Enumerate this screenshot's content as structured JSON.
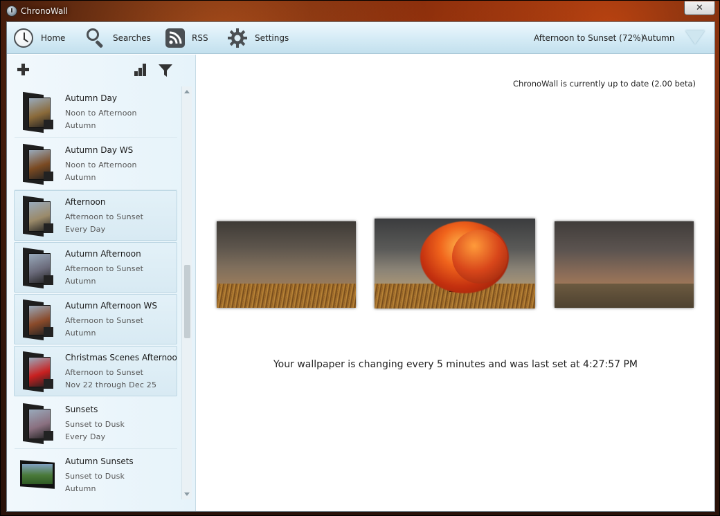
{
  "window": {
    "title": "ChronoWall",
    "close_label": "✕"
  },
  "toolbar": {
    "home_label": "Home",
    "searches_label": "Searches",
    "rss_label": "RSS",
    "settings_label": "Settings",
    "current_period": "Afternoon to Sunset (72%)",
    "current_theme": "Autumn"
  },
  "main": {
    "update_status": "ChronoWall is currently up to date (2.00 beta)",
    "caption": "Your wallpaper is changing every 5 minutes and was last set at 4:27:57 PM"
  },
  "sidebar": {
    "items": [
      {
        "name": "Autumn Day",
        "period": "Noon to Afternoon",
        "schedule": "Autumn",
        "highlighted": false,
        "pic": "#8a6a3a"
      },
      {
        "name": "Autumn Day WS",
        "period": "Noon to Afternoon",
        "schedule": "Autumn",
        "highlighted": false,
        "pic": "#7a4a22"
      },
      {
        "name": "Afternoon",
        "period": "Afternoon to Sunset",
        "schedule": "Every Day",
        "highlighted": true,
        "pic": "#9a8a6a"
      },
      {
        "name": "Autumn Afternoon",
        "period": "Afternoon to Sunset",
        "schedule": "Autumn",
        "highlighted": true,
        "pic": "#6a6a7a"
      },
      {
        "name": "Autumn Afternoon WS",
        "period": "Afternoon to Sunset",
        "schedule": "Autumn",
        "highlighted": true,
        "pic": "#8a4a2a"
      },
      {
        "name": "Christmas Scenes Afternoon",
        "period": "Afternoon to Sunset",
        "schedule": "Nov 22 through Dec 25",
        "highlighted": true,
        "pic": "#c82020"
      },
      {
        "name": "Sunsets",
        "period": "Sunset to Dusk",
        "schedule": "Every Day",
        "highlighted": false,
        "pic": "#8a7080"
      },
      {
        "name": "Autumn Sunsets",
        "period": "Sunset to Dusk",
        "schedule": "Autumn",
        "highlighted": false,
        "pic": "#3a7a3a"
      }
    ]
  }
}
